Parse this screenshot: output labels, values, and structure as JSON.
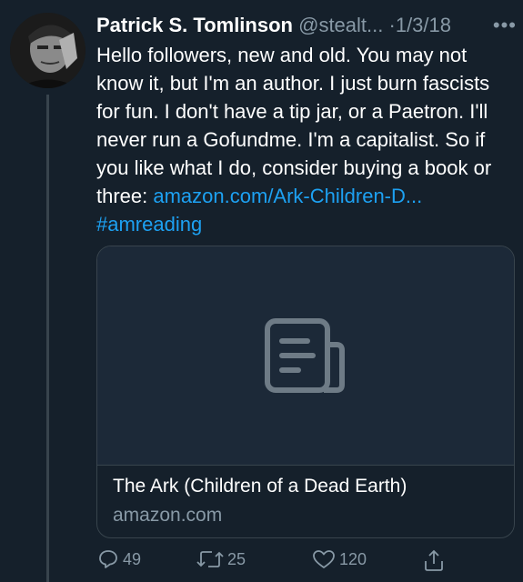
{
  "tweet": {
    "author_name": "Patrick S. Tomlinson",
    "handle": "@stealt...",
    "separator": "·",
    "date": "1/3/18",
    "more_label": "•••",
    "text": "Hello followers, new and old. You may not know it, but I'm an author. I just burn fascists for fun. I don't have a tip jar, or a Paetron. I'll never run a Gofundme. I'm a capitalist. So if you like what I do, consider buying a book or three: ",
    "link_text": "amazon.com/Ark-Children-D...",
    "hashtag": "#amreading"
  },
  "card": {
    "title": "The Ark (Children of a Dead Earth)",
    "domain": "amazon.com",
    "icon": "document-icon"
  },
  "actions": {
    "replies": "49",
    "retweets": "25",
    "likes": "120"
  },
  "colors": {
    "background": "#15202b",
    "text": "#ffffff",
    "secondary": "#8899a6",
    "link": "#1da1f2",
    "border": "#38444d"
  }
}
